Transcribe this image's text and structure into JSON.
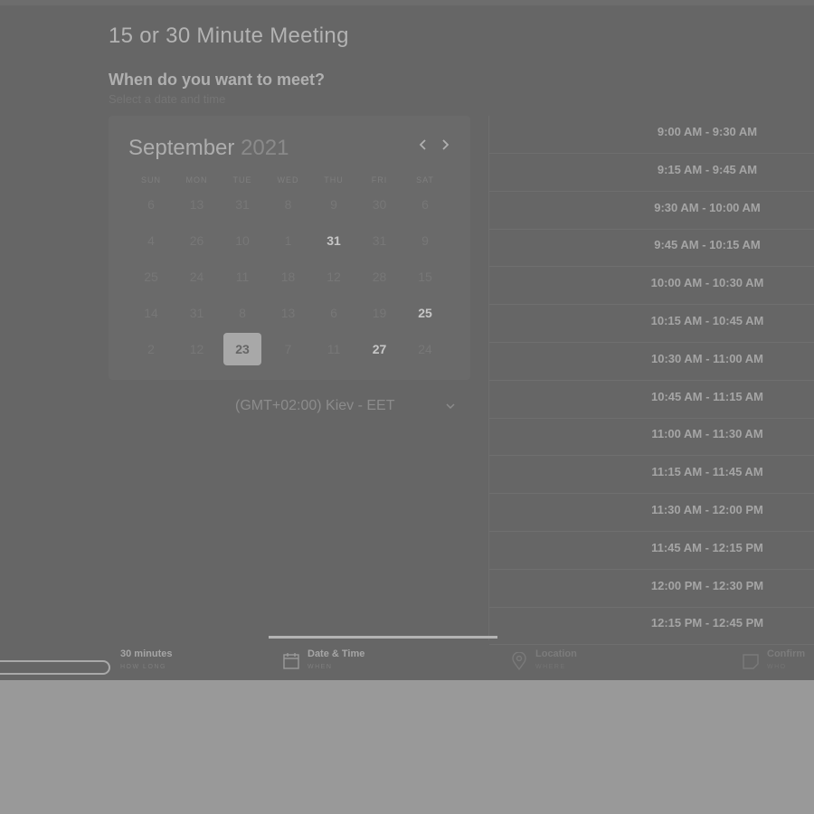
{
  "page": {
    "title": "15 or 30 Minute Meeting",
    "question": "When do you want to meet?",
    "subtitle": "Select a date and time"
  },
  "calendar": {
    "month": "September",
    "year": "2021",
    "weekdays": [
      "SUN",
      "MON",
      "TUE",
      "WED",
      "THU",
      "FRI",
      "SAT"
    ],
    "weeks": [
      [
        "6",
        "13",
        "31",
        "8",
        "9",
        "30",
        "6"
      ],
      [
        "4",
        "26",
        "10",
        "1",
        "31",
        "31",
        "9"
      ],
      [
        "25",
        "24",
        "11",
        "18",
        "12",
        "28",
        "15"
      ],
      [
        "14",
        "31",
        "8",
        "13",
        "6",
        "19",
        "25"
      ],
      [
        "2",
        "12",
        "23",
        "7",
        "11",
        "27",
        "24"
      ]
    ],
    "available": [
      [
        1,
        4
      ],
      [
        3,
        6
      ],
      [
        4,
        5
      ]
    ],
    "selected": [
      4,
      2
    ]
  },
  "timezone": {
    "label": "(GMT+02:00) Kiev - EET"
  },
  "time_slots": [
    "9:00 AM - 9:30 AM",
    "9:15 AM - 9:45 AM",
    "9:30 AM - 10:00 AM",
    "9:45 AM - 10:15 AM",
    "10:00 AM - 10:30 AM",
    "10:15 AM - 10:45 AM",
    "10:30 AM - 11:00 AM",
    "10:45 AM - 11:15 AM",
    "11:00 AM - 11:30 AM",
    "11:15 AM - 11:45 AM",
    "11:30 AM - 12:00 PM",
    "11:45 AM - 12:15 PM",
    "12:00 PM - 12:30 PM",
    "12:15 PM - 12:45 PM"
  ],
  "steps": [
    {
      "title": "30 minutes",
      "sub": "HOW LONG",
      "icon": "duration-pill-icon"
    },
    {
      "title": "Date & Time",
      "sub": "WHEN",
      "icon": "calendar-icon"
    },
    {
      "title": "Location",
      "sub": "WHERE",
      "icon": "location-pin-icon"
    },
    {
      "title": "Confirm",
      "sub": "WHO",
      "icon": "document-icon"
    }
  ],
  "colors": {
    "overlay": "#666666",
    "page_bottom": "#999999",
    "selected_day": "#a8a8a8",
    "active_step_bar": "#b4b4b4"
  }
}
